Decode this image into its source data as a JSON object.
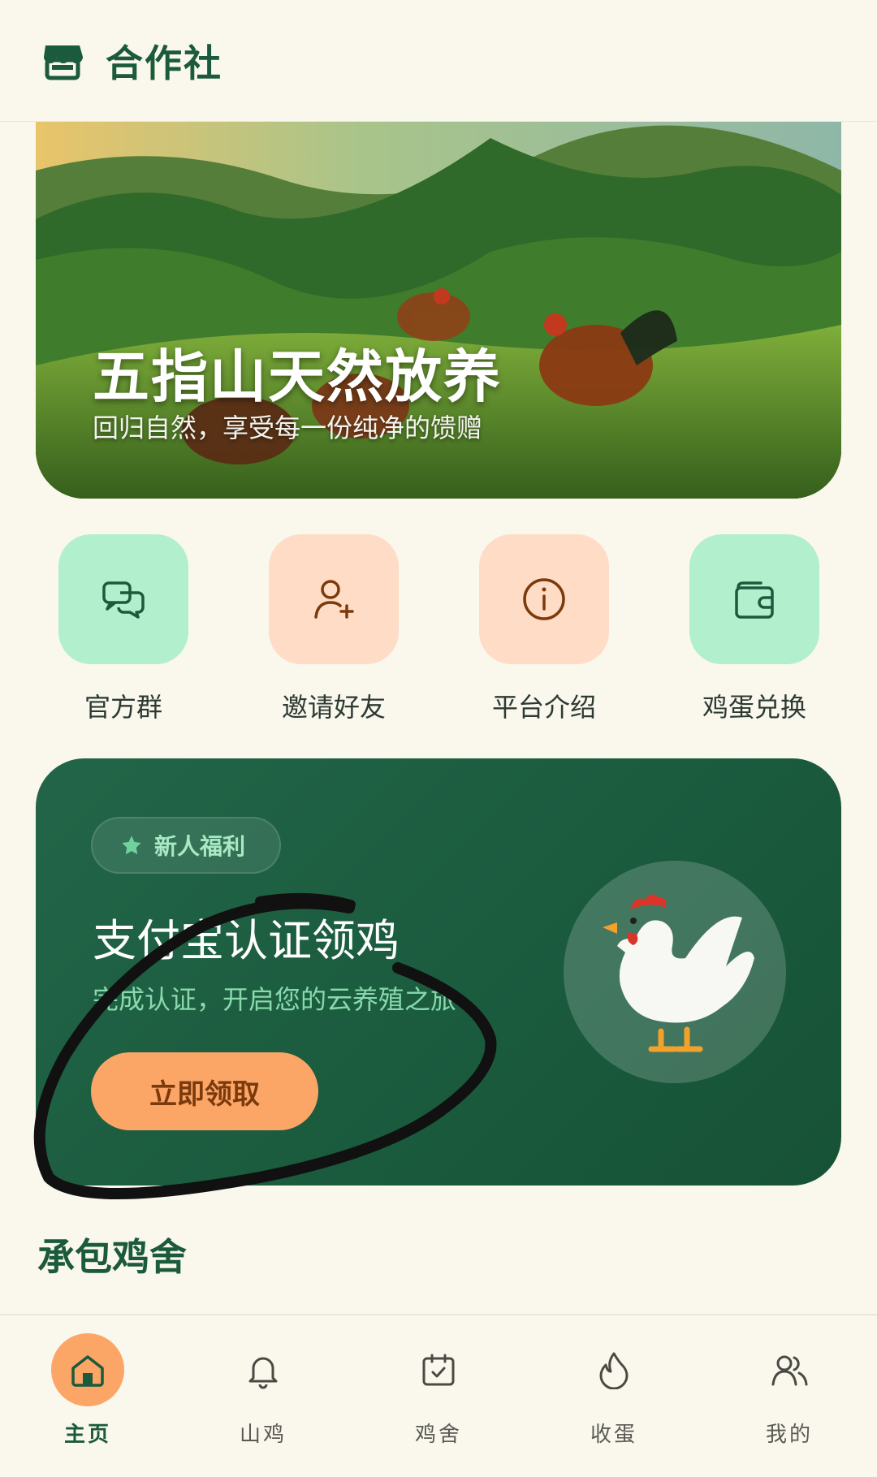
{
  "header": {
    "title": "合作社",
    "icon": "store-icon"
  },
  "banner": {
    "title": "五指山天然放养",
    "subtitle": "回归自然，享受每一份纯净的馈赠"
  },
  "actions": [
    {
      "label": "官方群",
      "icon": "chat-bubbles-icon",
      "bg": "mint"
    },
    {
      "label": "邀请好友",
      "icon": "add-user-icon",
      "bg": "peach"
    },
    {
      "label": "平台介绍",
      "icon": "info-icon",
      "bg": "peach"
    },
    {
      "label": "鸡蛋兑换",
      "icon": "wallet-icon",
      "bg": "mint"
    }
  ],
  "promo": {
    "badge": "新人福利",
    "title": "支付宝认证领鸡",
    "subtitle": "完成认证，开启您的云养殖之旅",
    "cta": "立即领取"
  },
  "section": {
    "title": "承包鸡舍"
  },
  "nav": [
    {
      "label": "主页",
      "icon": "home-icon",
      "active": true
    },
    {
      "label": "山鸡",
      "icon": "bell-icon",
      "active": false
    },
    {
      "label": "鸡舍",
      "icon": "calendar-check-icon",
      "active": false
    },
    {
      "label": "收蛋",
      "icon": "flame-icon",
      "active": false
    },
    {
      "label": "我的",
      "icon": "users-icon",
      "active": false
    }
  ],
  "colors": {
    "primary": "#1b5a3c",
    "accent": "#fba566",
    "background": "#faf7ec",
    "mint": "#b2efcc",
    "peach": "#fedcc6"
  }
}
